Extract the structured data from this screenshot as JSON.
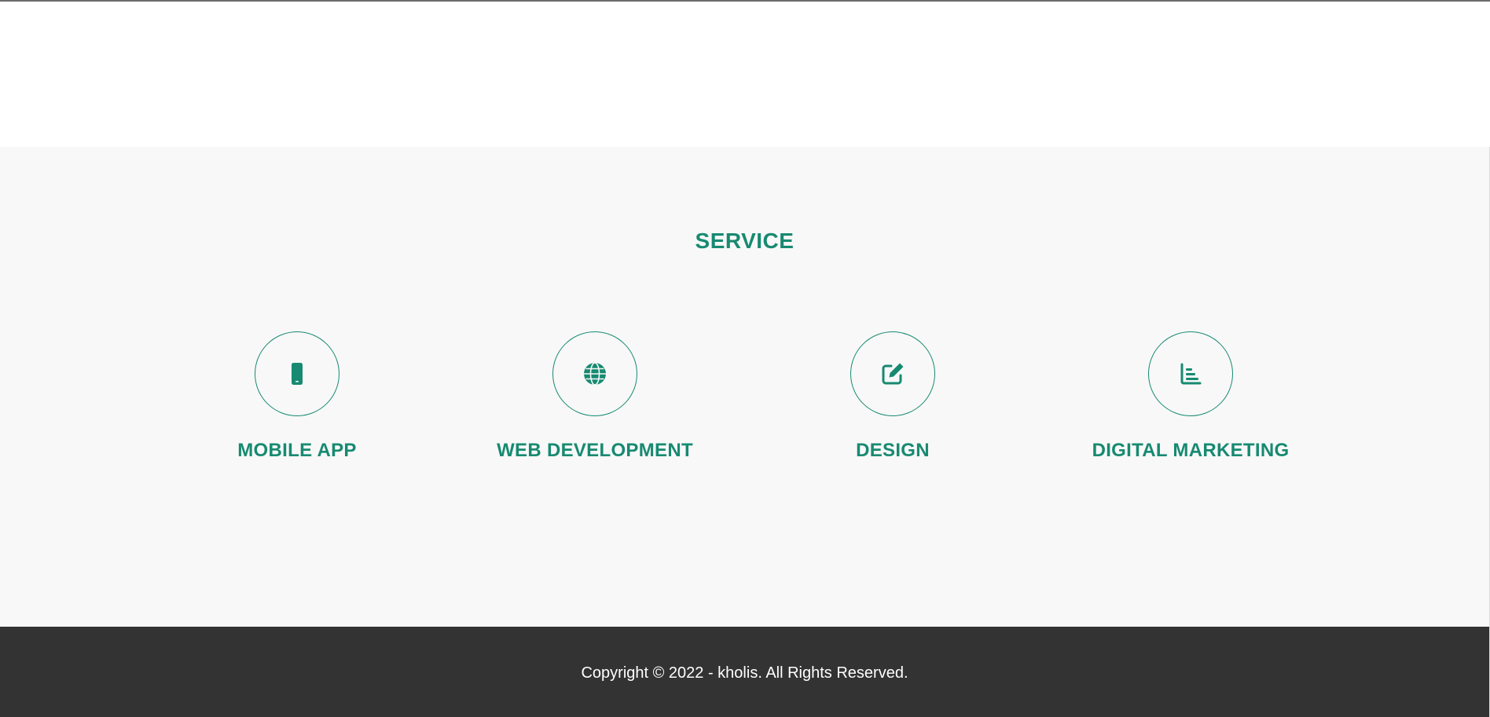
{
  "service": {
    "title": "SERVICE",
    "items": [
      {
        "label": "MOBILE APP",
        "icon": "mobile-phone-icon"
      },
      {
        "label": "WEB DEVELOPMENT",
        "icon": "globe-icon"
      },
      {
        "label": "DESIGN",
        "icon": "edit-pen-icon"
      },
      {
        "label": "DIGITAL MARKETING",
        "icon": "bar-chart-icon"
      }
    ]
  },
  "footer": {
    "copyright": "Copyright © 2022 - kholis. All Rights Reserved."
  },
  "colors": {
    "accent": "#178a71",
    "section_background": "#f8f8f8",
    "footer_background": "#333333",
    "footer_text": "#ffffff"
  }
}
